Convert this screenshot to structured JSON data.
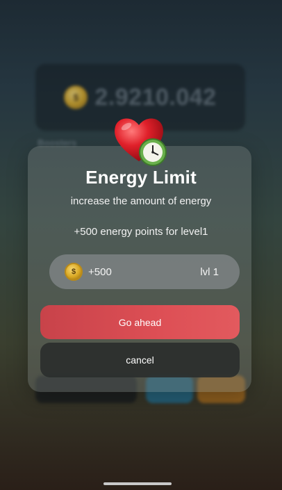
{
  "background": {
    "balance": "2.9210.042",
    "boosters_label": "Boosters"
  },
  "modal": {
    "title": "Energy Limit",
    "subtitle": "increase the amount of energy",
    "detail": "+500 energy points for level1",
    "pill": {
      "amount": "+500",
      "level": "lvl 1"
    },
    "primary_button_label": "Go ahead",
    "cancel_button_label": "cancel",
    "colors": {
      "primary": "#dd4f55",
      "cancel": "#2a2e2c"
    }
  },
  "icons": {
    "hero": "heart-clock-icon",
    "currency": "coin-icon"
  }
}
